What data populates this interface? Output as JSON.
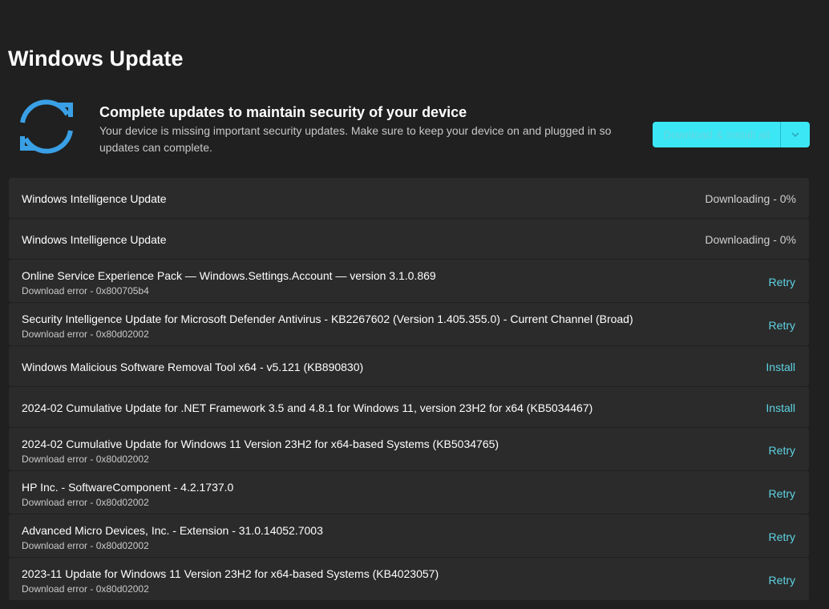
{
  "page": {
    "title": "Windows Update"
  },
  "hero": {
    "heading": "Complete updates to maintain security of your device",
    "description": "Your device is missing important security updates. Make sure to keep your device on and plugged in so updates can complete.",
    "icon": "sync-icon",
    "icon_color": "#3aa0e6"
  },
  "actions": {
    "download_all_label": "Download & install all",
    "accent_color": "#3be7f4"
  },
  "updates": [
    {
      "title": "Windows Intelligence Update",
      "subtitle": "",
      "status": "Downloading - 0%",
      "action": ""
    },
    {
      "title": "Windows Intelligence Update",
      "subtitle": "",
      "status": "Downloading - 0%",
      "action": ""
    },
    {
      "title": "Online Service Experience Pack — Windows.Settings.Account — version 3.1.0.869",
      "subtitle": "Download error - 0x800705b4",
      "status": "",
      "action": "Retry"
    },
    {
      "title": "Security Intelligence Update for Microsoft Defender Antivirus - KB2267602 (Version 1.405.355.0) - Current Channel (Broad)",
      "subtitle": "Download error - 0x80d02002",
      "status": "",
      "action": "Retry"
    },
    {
      "title": "Windows Malicious Software Removal Tool x64 - v5.121 (KB890830)",
      "subtitle": "",
      "status": "",
      "action": "Install"
    },
    {
      "title": "2024-02 Cumulative Update for .NET Framework 3.5 and 4.8.1 for Windows 11, version 23H2 for x64 (KB5034467)",
      "subtitle": "",
      "status": "",
      "action": "Install"
    },
    {
      "title": "2024-02 Cumulative Update for Windows 11 Version 23H2 for x64-based Systems (KB5034765)",
      "subtitle": "Download error - 0x80d02002",
      "status": "",
      "action": "Retry"
    },
    {
      "title": "HP Inc. - SoftwareComponent - 4.2.1737.0",
      "subtitle": "Download error - 0x80d02002",
      "status": "",
      "action": "Retry"
    },
    {
      "title": "Advanced Micro Devices, Inc. - Extension - 31.0.14052.7003",
      "subtitle": "Download error - 0x80d02002",
      "status": "",
      "action": "Retry"
    },
    {
      "title": "2023-11 Update for Windows 11 Version 23H2 for x64-based Systems (KB4023057)",
      "subtitle": "Download error - 0x80d02002",
      "status": "",
      "action": "Retry"
    }
  ]
}
